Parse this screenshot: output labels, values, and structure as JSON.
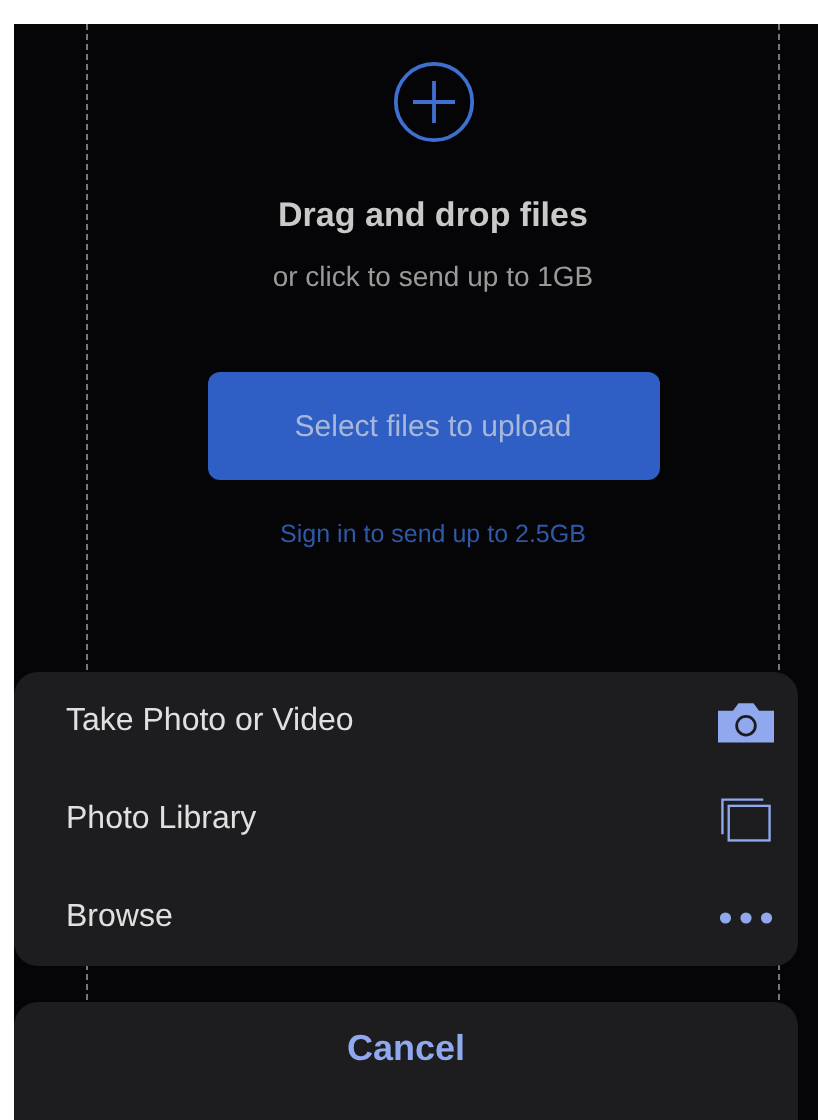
{
  "upload": {
    "title": "Drag and drop files",
    "subtitle": "or click to send up to 1GB",
    "button": "Select files to upload",
    "link": "Sign in to send up to 2.5GB"
  },
  "action_sheet": {
    "options": [
      {
        "label": "Take Photo or Video",
        "kind": "camera"
      },
      {
        "label": "Photo Library",
        "kind": "library"
      },
      {
        "label": "Browse",
        "kind": "more"
      }
    ],
    "cancel": "Cancel"
  }
}
